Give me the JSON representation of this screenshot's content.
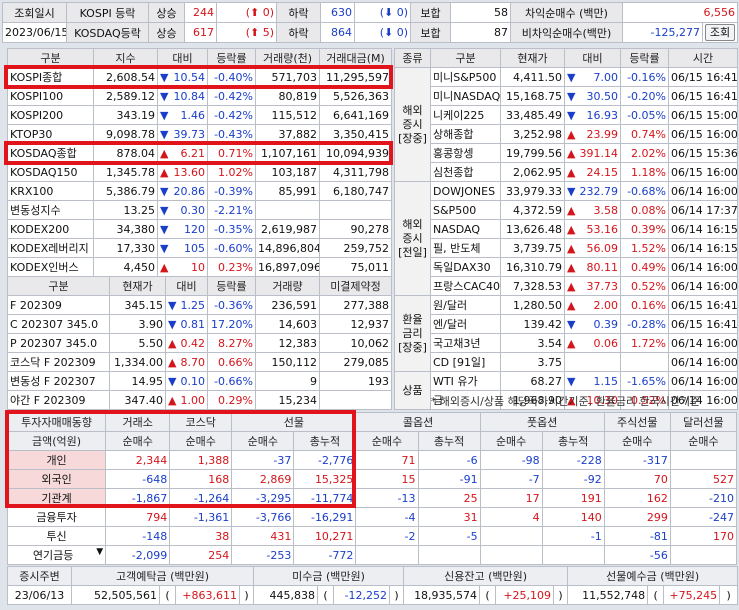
{
  "top": {
    "row1": {
      "label": "조회일시",
      "market": "KOSPI 등락",
      "up_label": "상승",
      "up_val": "244",
      "up_chg": "0",
      "down_label": "하락",
      "down_val": "630",
      "down_chg": "0",
      "flat_label": "보합",
      "flat_val": "58",
      "arb_label": "차익순매수 (백만)",
      "arb_val": "6,556"
    },
    "row2": {
      "date": "2023/06/15",
      "market": "KOSDAQ등락",
      "up_label": "상승",
      "up_val": "617",
      "up_chg": "5",
      "down_label": "하락",
      "down_val": "864",
      "down_chg": "0",
      "flat_label": "보합",
      "flat_val": "87",
      "arb_label": "비차익순매수(백만)",
      "arb_val": "-125,277"
    },
    "query_button": "조회"
  },
  "index": {
    "headers": [
      "구분",
      "지수",
      "대비",
      "등락률",
      "거래량(천)",
      "거래대금(M)"
    ],
    "rows": [
      {
        "name": "KOSPI종합",
        "val": "2,608.54",
        "dir": "down",
        "chg": "10.54",
        "rate": "-0.40%",
        "vol": "571,703",
        "amt": "11,295,597"
      },
      {
        "name": "KOSPI100",
        "val": "2,589.12",
        "dir": "down",
        "chg": "10.84",
        "rate": "-0.42%",
        "vol": "80,819",
        "amt": "5,526,363"
      },
      {
        "name": "KOSPI200",
        "val": "343.19",
        "dir": "down",
        "chg": "1.46",
        "rate": "-0.42%",
        "vol": "115,512",
        "amt": "6,641,169"
      },
      {
        "name": "KTOP30",
        "val": "9,098.78",
        "dir": "down",
        "chg": "39.73",
        "rate": "-0.43%",
        "vol": "37,882",
        "amt": "3,350,415"
      },
      {
        "name": "KOSDAQ종합",
        "val": "878.04",
        "dir": "up",
        "chg": "6.21",
        "rate": "0.71%",
        "vol": "1,107,161",
        "amt": "10,094,939"
      },
      {
        "name": "KOSDAQ150",
        "val": "1,345.78",
        "dir": "up",
        "chg": "13.60",
        "rate": "1.02%",
        "vol": "103,187",
        "amt": "4,311,798"
      },
      {
        "name": "KRX100",
        "val": "5,386.79",
        "dir": "down",
        "chg": "20.86",
        "rate": "-0.39%",
        "vol": "85,991",
        "amt": "6,180,747"
      },
      {
        "name": "변동성지수",
        "val": "13.25",
        "dir": "down",
        "chg": "0.30",
        "rate": "-2.21%",
        "vol": "",
        "amt": ""
      },
      {
        "name": "KODEX200",
        "val": "34,380",
        "dir": "down",
        "chg": "120",
        "rate": "-0.35%",
        "vol": "2,619,987",
        "amt": "90,278"
      },
      {
        "name": "KODEX레버리지",
        "val": "17,330",
        "dir": "down",
        "chg": "105",
        "rate": "-0.60%",
        "vol": "14,896,804",
        "amt": "259,752"
      },
      {
        "name": "KODEX인버스",
        "val": "4,450",
        "dir": "up",
        "chg": "10",
        "rate": "0.23%",
        "vol": "16,897,096",
        "amt": "75,011"
      }
    ]
  },
  "futures": {
    "headers": [
      "구분",
      "현재가",
      "대비",
      "등락률",
      "거래량",
      "미결제약정"
    ],
    "rows": [
      {
        "name": "F 202309",
        "val": "345.15",
        "dir": "down",
        "chg": "1.25",
        "rate": "-0.36%",
        "vol": "236,591",
        "oi": "277,388"
      },
      {
        "name": "C 202307 345.0",
        "val": "3.90",
        "dir": "down",
        "chg": "0.81",
        "rate": "17.20%",
        "vol": "14,603",
        "oi": "12,937"
      },
      {
        "name": "P 202307 345.0",
        "val": "5.50",
        "dir": "up",
        "chg": "0.42",
        "rate": "8.27%",
        "vol": "12,383",
        "oi": "10,062"
      },
      {
        "name": "코스닥 F 202309",
        "val": "1,334.00",
        "dir": "up",
        "chg": "8.70",
        "rate": "0.66%",
        "vol": "150,112",
        "oi": "279,085"
      },
      {
        "name": "변동성 F 202307",
        "val": "14.95",
        "dir": "down",
        "chg": "0.10",
        "rate": "-0.66%",
        "vol": "9",
        "oi": "193"
      },
      {
        "name": "야간 F 202309",
        "val": "347.40",
        "dir": "up",
        "chg": "1.00",
        "rate": "0.29%",
        "vol": "15,234",
        "oi": ""
      }
    ]
  },
  "overseas": {
    "headers": [
      "종류",
      "구분",
      "현재가",
      "대비",
      "등락률",
      "시간"
    ],
    "groups": [
      {
        "label": "해외\n증시\n[장중]",
        "rows": [
          {
            "name": "미니S&P500",
            "val": "4,411.50",
            "dir": "down",
            "chg": "7.00",
            "rate": "-0.16%",
            "time": "06/15 16:41"
          },
          {
            "name": "미니NASDAQ",
            "val": "15,168.75",
            "dir": "down",
            "chg": "30.50",
            "rate": "-0.20%",
            "time": "06/15 16:41"
          },
          {
            "name": "니케이225",
            "val": "33,485.49",
            "dir": "down",
            "chg": "16.93",
            "rate": "-0.05%",
            "time": "06/15 15:00"
          },
          {
            "name": "상해종합",
            "val": "3,252.98",
            "dir": "up",
            "chg": "23.99",
            "rate": "0.74%",
            "time": "06/15 16:00"
          },
          {
            "name": "홍콩항셍",
            "val": "19,799.56",
            "dir": "up",
            "chg": "391.14",
            "rate": "2.02%",
            "time": "06/15 15:36"
          },
          {
            "name": "심천종합",
            "val": "2,062.95",
            "dir": "up",
            "chg": "24.15",
            "rate": "1.18%",
            "time": "06/15 16:00"
          }
        ]
      },
      {
        "label": "해외\n증시\n[전일]",
        "rows": [
          {
            "name": "DOWJONES",
            "val": "33,979.33",
            "dir": "down",
            "chg": "232.79",
            "rate": "-0.68%",
            "time": "06/14 16:00"
          },
          {
            "name": "S&P500",
            "val": "4,372.59",
            "dir": "up",
            "chg": "3.58",
            "rate": "0.08%",
            "time": "06/14 17:37"
          },
          {
            "name": "NASDAQ",
            "val": "13,626.48",
            "dir": "up",
            "chg": "53.16",
            "rate": "0.39%",
            "time": "06/14 16:15"
          },
          {
            "name": "필, 반도체",
            "val": "3,739.75",
            "dir": "up",
            "chg": "56.09",
            "rate": "1.52%",
            "time": "06/14 16:15"
          },
          {
            "name": "독일DAX30",
            "val": "16,310.79",
            "dir": "up",
            "chg": "80.11",
            "rate": "0.49%",
            "time": "06/14 16:00"
          },
          {
            "name": "프랑스CAC40",
            "val": "7,328.53",
            "dir": "up",
            "chg": "37.73",
            "rate": "0.52%",
            "time": "06/14 16:00"
          }
        ]
      },
      {
        "label": "환율\n금리\n[장중]",
        "rows": [
          {
            "name": "원/달러",
            "val": "1,280.50",
            "dir": "up",
            "chg": "2.00",
            "rate": "0.16%",
            "time": "06/15 16:41"
          },
          {
            "name": "엔/달러",
            "val": "139.42",
            "dir": "down",
            "chg": "0.39",
            "rate": "-0.28%",
            "time": "06/15 16:41"
          },
          {
            "name": "국고채3년",
            "val": "3.54",
            "dir": "up",
            "chg": "0.06",
            "rate": "1.72%",
            "time": "06/14 16:00"
          },
          {
            "name": "CD [91일]",
            "val": "3.75",
            "dir": "",
            "chg": "",
            "rate": "",
            "time": "06/14 16:00"
          }
        ]
      },
      {
        "label": "상품",
        "rows": [
          {
            "name": "WTI 유가",
            "val": "68.27",
            "dir": "down",
            "chg": "1.15",
            "rate": "-1.65%",
            "time": "06/14 16:00"
          },
          {
            "name": "금",
            "val": "1,968.90",
            "dir": "up",
            "chg": "10.30",
            "rate": "0.52%",
            "time": "06/14 16:00"
          }
        ]
      }
    ],
    "note": "* 해외증시/상품 해당국가시간기준, 환율금리 한국시간기준"
  },
  "investor": {
    "title": "투자자매매동향",
    "unit_label": "금액(억원)",
    "groups": [
      "거래소",
      "코스닥",
      "선물",
      "콜옵션",
      "풋옵션",
      "주식선물",
      "달러선물"
    ],
    "sub": [
      "순매수",
      "순매수",
      "순매수",
      "총누적",
      "순매수",
      "총누적",
      "순매수",
      "총누적",
      "순매수",
      "순매수"
    ],
    "rows": [
      {
        "name": "개인",
        "vals": [
          "2,344",
          "1,388",
          "-37",
          "-2,776",
          "71",
          "-6",
          "-98",
          "-228",
          "-317"
        ],
        "cls": [
          "up",
          "up",
          "dn",
          "dn",
          "up",
          "dn",
          "dn",
          "dn",
          "dn"
        ]
      },
      {
        "name": "외국인",
        "vals": [
          "-648",
          "168",
          "2,869",
          "15,325",
          "15",
          "-91",
          "-7",
          "-92",
          "70",
          "527"
        ],
        "cls": [
          "dn",
          "up",
          "up",
          "up",
          "up",
          "dn",
          "dn",
          "dn",
          "up",
          "up"
        ]
      },
      {
        "name": "기관계",
        "vals": [
          "-1,867",
          "-1,264",
          "-3,295",
          "-11,774",
          "-13",
          "25",
          "17",
          "191",
          "162",
          "-210"
        ],
        "cls": [
          "dn",
          "dn",
          "dn",
          "dn",
          "dn",
          "up",
          "up",
          "up",
          "up",
          "dn"
        ]
      },
      {
        "name": "금융투자",
        "vals": [
          "794",
          "-1,361",
          "-3,766",
          "-16,291",
          "-4",
          "31",
          "4",
          "140",
          "299",
          "-247"
        ],
        "cls": [
          "up",
          "dn",
          "dn",
          "dn",
          "dn",
          "up",
          "up",
          "up",
          "up",
          "dn"
        ]
      },
      {
        "name": "투신",
        "vals": [
          "-148",
          "38",
          "431",
          "10,271",
          "-2",
          "-5",
          "",
          "-1",
          "-81",
          "170"
        ],
        "cls": [
          "dn",
          "up",
          "up",
          "up",
          "dn",
          "dn",
          "",
          "dn",
          "dn",
          "up"
        ]
      },
      {
        "name": "연기금등",
        "vals": [
          "-2,099",
          "254",
          "-253",
          "-772",
          "",
          "",
          "",
          "",
          "-56",
          ""
        ],
        "cls": [
          "dn",
          "up",
          "dn",
          "dn",
          "",
          "",
          "",
          "",
          "dn",
          ""
        ]
      }
    ]
  },
  "bottom": {
    "headers": [
      "증시주변",
      "고객예탁금 (백만원)",
      "미수금 (백만원)",
      "신용잔고 (백만원)",
      "선물예수금 (백만원)"
    ],
    "date": "23/06/13",
    "deposit": "52,505,561",
    "deposit_chg": "+863,611",
    "unpaid": "445,838",
    "unpaid_chg": "-12,252",
    "credit": "18,935,574",
    "credit_chg": "+25,109",
    "fut": "11,552,748",
    "fut_chg": "+75,245"
  },
  "colors": {
    "up": "#d4151b",
    "down": "#1a3ec9",
    "highlight": "#e2141b"
  }
}
